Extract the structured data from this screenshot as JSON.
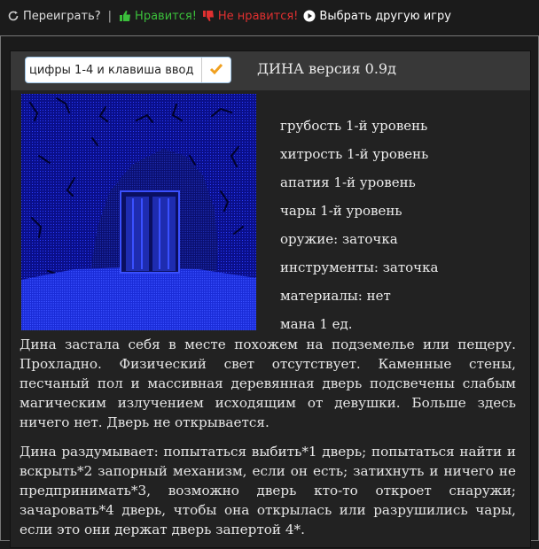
{
  "topbar": {
    "replay": "Переиграть?",
    "separator": "|",
    "like": "Нравится!",
    "dislike": "Не нравится!",
    "choose": "Выбрать другую игру"
  },
  "header": {
    "placeholder": "цифры 1-4 и клавиша ввод",
    "title": "ДИНА версия 0.9д"
  },
  "stats": [
    "грубость 1-й уровень",
    "хитрость 1-й уровень",
    "апатия 1-й уровень",
    "чары 1-й уровень",
    "оружие: заточка",
    "инструменты: заточка",
    "материалы: нет",
    "мана 1 ед."
  ],
  "description": [
    "Дина застала себя в месте похожем на подземелье или пещеру. Прохладно. Физический свет отсутствует. Каменные стены, песчаный пол и массивная деревянная дверь подсвечены слабым магическим излучением исходящим от девушки. Больше здесь ничего нет. Дверь не открывается.",
    "Дина раздумывает: попытаться выбить*1 дверь; попытаться найти и вскрыть*2 запорный механизм, если он есть; затихнуть и ничего не предпринимать*3, возможно дверь кто-то откроет снаружи; зачаровать*4 дверь, чтобы она открылась или разрушились чары, если это они держат дверь запертой 4*."
  ],
  "colors": {
    "like": "#3bbf3b",
    "dislike": "#e03030",
    "accent": "#f0a020",
    "picture_bg": "#0a0f8a"
  },
  "icons": {
    "replay": "refresh-icon",
    "like": "thumbs-up-icon",
    "dislike": "thumbs-down-icon",
    "choose": "play-circle-icon",
    "submit": "checkmark-icon"
  }
}
